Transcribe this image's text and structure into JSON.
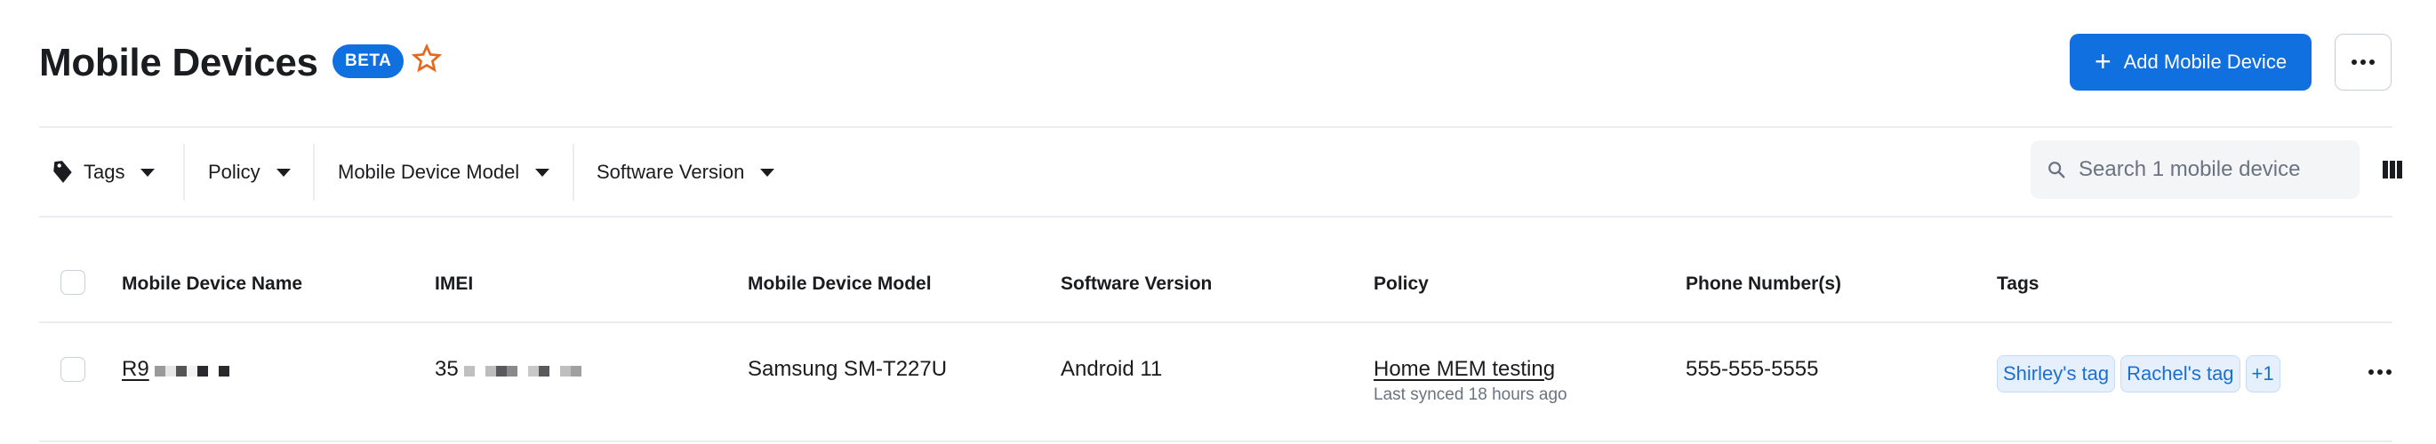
{
  "header": {
    "title": "Mobile Devices",
    "badge": "BETA",
    "favorite_icon": "star-outline-icon",
    "add_button": {
      "icon": "plus-icon",
      "label": "Add Mobile Device"
    },
    "more_button": {
      "icon": "more-horizontal-icon"
    }
  },
  "colors": {
    "primary": "#1070e0",
    "star": "#e8671f",
    "tag_bg": "#e5f0fc",
    "tag_text": "#1b6fd2",
    "muted_text": "#6a7381"
  },
  "toolbar": {
    "filters": [
      {
        "label": "Tags",
        "icon": "tag-icon"
      },
      {
        "label": "Policy"
      },
      {
        "label": "Mobile Device Model"
      },
      {
        "label": "Software Version"
      }
    ],
    "search": {
      "placeholder": "Search 1 mobile device",
      "value": ""
    },
    "columns_icon": "columns-icon"
  },
  "table": {
    "columns": [
      "Mobile Device Name",
      "IMEI",
      "Mobile Device Model",
      "Software Version",
      "Policy",
      "Phone Number(s)",
      "Tags"
    ],
    "rows": [
      {
        "name_visible": "R9",
        "imei_visible": "35",
        "model": "Samsung SM-T227U",
        "software_version": "Android 11",
        "policy": "Home MEM testing",
        "policy_sync": "Last synced 18 hours ago",
        "phone": "555-555-5555",
        "tags": [
          "Shirley's tag",
          "Rachel's tag"
        ],
        "tags_more": "+1"
      }
    ]
  }
}
